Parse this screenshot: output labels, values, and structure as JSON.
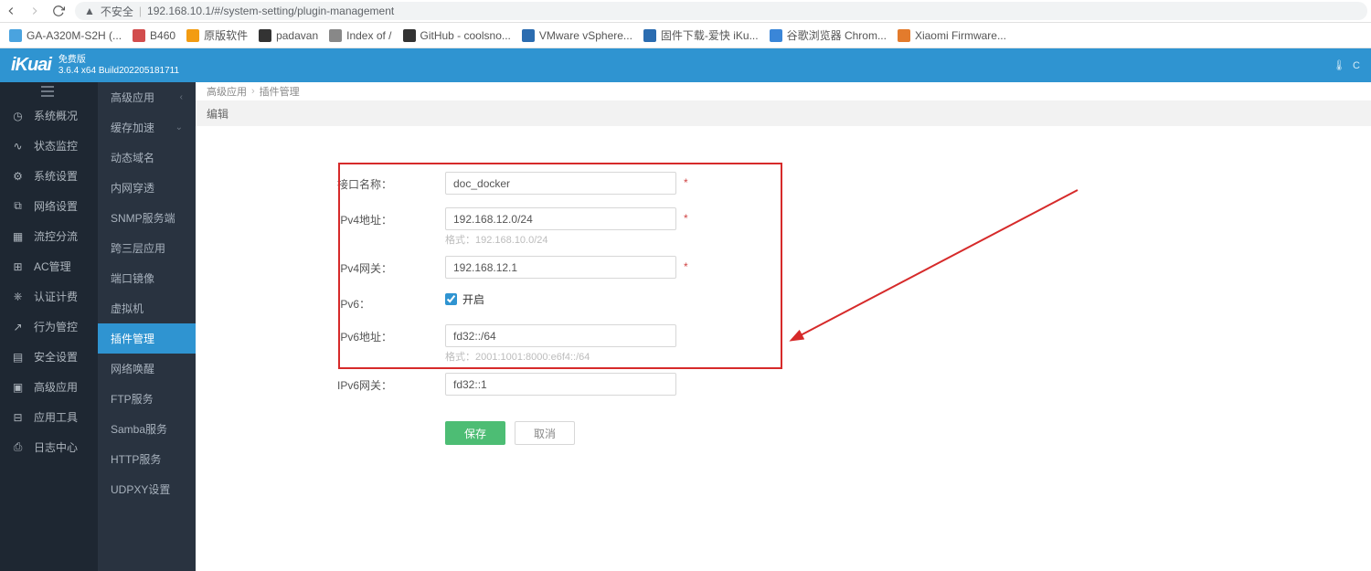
{
  "browser": {
    "url_prefix": "不安全",
    "url": "192.168.10.1/#/system-setting/plugin-management"
  },
  "bookmarks": [
    {
      "label": "GA-A320M-S2H (...",
      "color": "#4aa3df"
    },
    {
      "label": "B460",
      "color": "#d24d4d"
    },
    {
      "label": "原版软件",
      "color": "#f39c12"
    },
    {
      "label": "padavan",
      "color": "#333"
    },
    {
      "label": "Index of /",
      "color": "#888"
    },
    {
      "label": "GitHub - coolsno...",
      "color": "#333"
    },
    {
      "label": "VMware vSphere...",
      "color": "#2b6cb0"
    },
    {
      "label": "固件下载-爱快 iKu...",
      "color": "#2b6cb0"
    },
    {
      "label": "谷歌浏览器 Chrom...",
      "color": "#3a86d8"
    },
    {
      "label": "Xiaomi Firmware...",
      "color": "#e37b2c"
    }
  ],
  "header": {
    "logo": "iKuai",
    "edition": "免费版",
    "build": "3.6.4 x64 Build202205181711"
  },
  "sidebar_primary": [
    {
      "label": "系统概况"
    },
    {
      "label": "状态监控"
    },
    {
      "label": "系统设置"
    },
    {
      "label": "网络设置"
    },
    {
      "label": "流控分流"
    },
    {
      "label": "AC管理"
    },
    {
      "label": "认证计费"
    },
    {
      "label": "行为管控"
    },
    {
      "label": "安全设置"
    },
    {
      "label": "高级应用"
    },
    {
      "label": "应用工具"
    },
    {
      "label": "日志中心"
    }
  ],
  "sidebar_secondary_header": "高级应用",
  "sidebar_secondary": [
    {
      "label": "缓存加速",
      "expand": true
    },
    {
      "label": "动态域名"
    },
    {
      "label": "内网穿透"
    },
    {
      "label": "SNMP服务端"
    },
    {
      "label": "跨三层应用"
    },
    {
      "label": "端口镜像"
    },
    {
      "label": "虚拟机"
    },
    {
      "label": "插件管理",
      "active": true
    },
    {
      "label": "网络唤醒"
    },
    {
      "label": "FTP服务"
    },
    {
      "label": "Samba服务"
    },
    {
      "label": "HTTP服务"
    },
    {
      "label": "UDPXY设置"
    }
  ],
  "breadcrumb": {
    "a": "高级应用",
    "b": "插件管理"
  },
  "subheader": "编辑",
  "form": {
    "labels": {
      "iface": "接口名称：",
      "ipv4": "IPv4地址：",
      "ipv4_hint": "格式：192.168.10.0/24",
      "ipv4gw": "IPv4网关：",
      "ipv6": "IPv6：",
      "ipv6_on": "开启",
      "ipv6addr": "IPv6地址：",
      "ipv6_hint": "格式：2001:1001:8000:e6f4::/64",
      "ipv6gw": "IPv6网关："
    },
    "values": {
      "iface": "doc_docker",
      "ipv4": "192.168.12.0/24",
      "ipv4gw": "192.168.12.1",
      "ipv6_enabled": true,
      "ipv6addr": "fd32::/64",
      "ipv6gw": "fd32::1"
    },
    "buttons": {
      "save": "保存",
      "cancel": "取消"
    }
  }
}
